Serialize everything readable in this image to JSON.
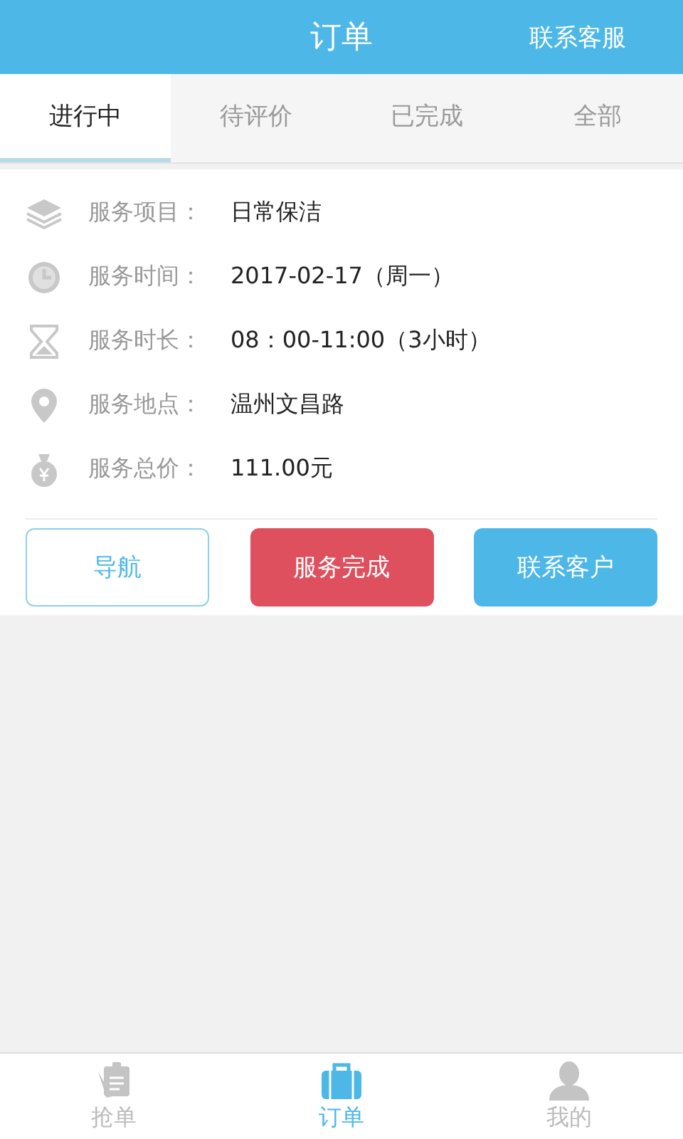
{
  "header": {
    "title": "订单",
    "action": "联系客服"
  },
  "tabs": [
    {
      "label": "进行中",
      "selected": true
    },
    {
      "label": "待评价",
      "selected": false
    },
    {
      "label": "已完成",
      "selected": false
    },
    {
      "label": "全部",
      "selected": false
    }
  ],
  "order": {
    "fields": [
      {
        "kind": "layers",
        "label": "服务项目：",
        "value": "日常保洁"
      },
      {
        "kind": "clock",
        "label": "服务时间：",
        "value": "2017-02-17（周一）"
      },
      {
        "kind": "hourglass",
        "label": "服务时长：",
        "value": "08：00-11:00（3小时）"
      },
      {
        "kind": "pin",
        "label": "服务地点：",
        "value": "温州文昌路"
      },
      {
        "kind": "money",
        "label": "服务总价：",
        "value": "111.00元"
      }
    ],
    "buttons": [
      {
        "kind": "outline",
        "label": "导航"
      },
      {
        "kind": "danger",
        "label": "服务完成"
      },
      {
        "kind": "primary",
        "label": "联系客户"
      }
    ]
  },
  "bottom_nav": [
    {
      "kind": "clipboard",
      "label": "抢单",
      "selected": false
    },
    {
      "kind": "briefcase",
      "label": "订单",
      "selected": true
    },
    {
      "kind": "person",
      "label": "我的",
      "selected": false
    }
  ]
}
